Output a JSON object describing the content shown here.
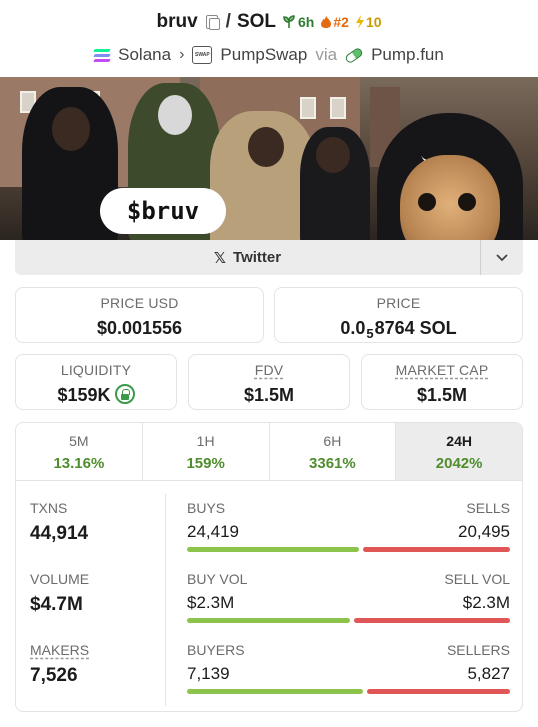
{
  "header": {
    "token": "bruv",
    "separator": "/",
    "quote": "SOL",
    "age": "6h",
    "rank": "#2",
    "boosts": "10",
    "chain": "Solana",
    "dex": "PumpSwap",
    "via": "via",
    "launchpad": "Pump.fun"
  },
  "banner": {
    "tag": "$bruv"
  },
  "twitter": {
    "label": "Twitter"
  },
  "price_usd": {
    "label": "PRICE USD",
    "value": "$0.001556"
  },
  "price": {
    "label": "PRICE",
    "prefix": "0.0",
    "zeros": "5",
    "digits": "8764 SOL"
  },
  "liquidity": {
    "label": "LIQUIDITY",
    "value": "$159K"
  },
  "fdv": {
    "label": "FDV",
    "value": "$1.5M"
  },
  "market_cap": {
    "label": "MARKET CAP",
    "value": "$1.5M"
  },
  "tabs": [
    {
      "label": "5M",
      "change": "13.16%"
    },
    {
      "label": "1H",
      "change": "159%"
    },
    {
      "label": "6H",
      "change": "3361%"
    },
    {
      "label": "24H",
      "change": "2042%"
    }
  ],
  "stats": {
    "txns": {
      "label": "TXNS",
      "value": "44,914"
    },
    "volume": {
      "label": "VOLUME",
      "value": "$4.7M"
    },
    "makers": {
      "label": "MAKERS",
      "value": "7,526"
    },
    "buys": {
      "label": "BUYS",
      "value": "24,419"
    },
    "sells": {
      "label": "SELLS",
      "value": "20,495"
    },
    "buy_vol": {
      "label": "BUY VOL",
      "value": "$2.3M"
    },
    "sell_vol": {
      "label": "SELL VOL",
      "value": "$2.3M"
    },
    "buyers": {
      "label": "BUYERS",
      "value": "7,139"
    },
    "sellers": {
      "label": "SELLERS",
      "value": "5,827"
    },
    "ratios": {
      "buys": 0.54,
      "buy_vol": 0.51,
      "buyers": 0.55
    }
  },
  "colors": {
    "positive": "#4f8d2d",
    "buy_bar": "#8cc34a",
    "sell_bar": "#e05656"
  }
}
